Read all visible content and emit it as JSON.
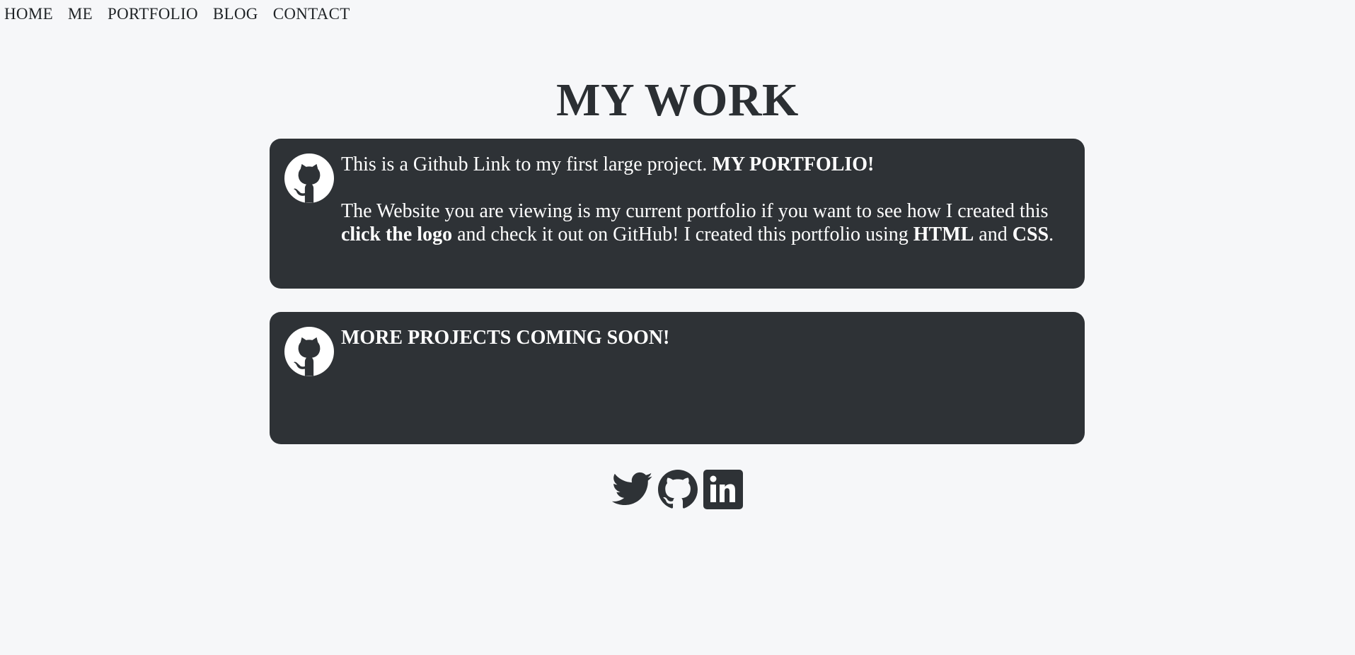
{
  "nav": {
    "items": [
      {
        "label": "HOME"
      },
      {
        "label": "ME"
      },
      {
        "label": "PORTFOLIO"
      },
      {
        "label": "BLOG"
      },
      {
        "label": "CONTACT"
      }
    ]
  },
  "title": "MY WORK",
  "cards": [
    {
      "icon": "github-icon",
      "line1_text": "This is a Github Link to my first large project. ",
      "line1_bold": "MY PORTFOLIO!",
      "para2_a": "The Website you are viewing is my current portfolio if you want to see how I created this ",
      "para2_b": "click the logo",
      "para2_c": " and check it out on GitHub! I created this portfolio using ",
      "para2_d": "HTML",
      "para2_e": " and ",
      "para2_f": "CSS",
      "para2_g": "."
    },
    {
      "icon": "github-icon",
      "heading": "MORE PROJECTS COMING SOON!"
    }
  ],
  "social": [
    {
      "icon": "twitter-icon"
    },
    {
      "icon": "github-icon"
    },
    {
      "icon": "linkedin-icon"
    }
  ],
  "colors": {
    "background": "#f6f7f9",
    "card": "#2e3236",
    "text_dark": "#2b2f33",
    "text_light": "#ffffff"
  }
}
